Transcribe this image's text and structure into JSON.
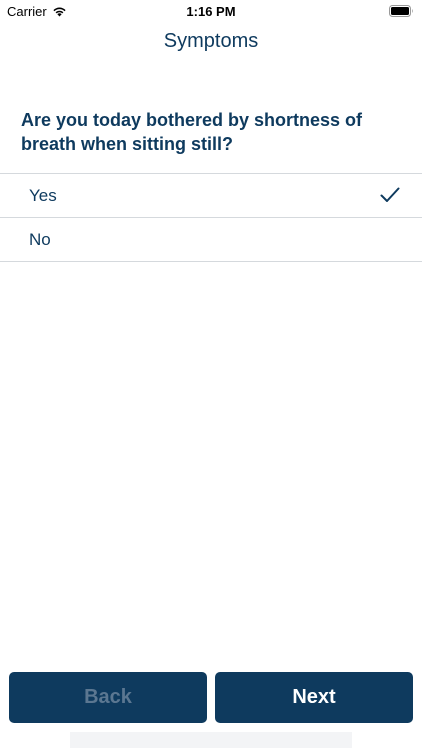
{
  "status_bar": {
    "carrier": "Carrier",
    "time": "1:16 PM",
    "icons": [
      "wifi-icon",
      "battery-icon"
    ]
  },
  "nav": {
    "title": "Symptoms"
  },
  "question": {
    "text": "Are you today bothered by shortness of breath when sitting still?"
  },
  "options": [
    {
      "label": "Yes",
      "selected": true
    },
    {
      "label": "No",
      "selected": false
    }
  ],
  "footer": {
    "back_label": "Back",
    "back_enabled": false,
    "next_label": "Next"
  },
  "colors": {
    "accent": "#0e3a5e",
    "divider": "#d5d9dd",
    "disabled_text": "#5b7791"
  }
}
